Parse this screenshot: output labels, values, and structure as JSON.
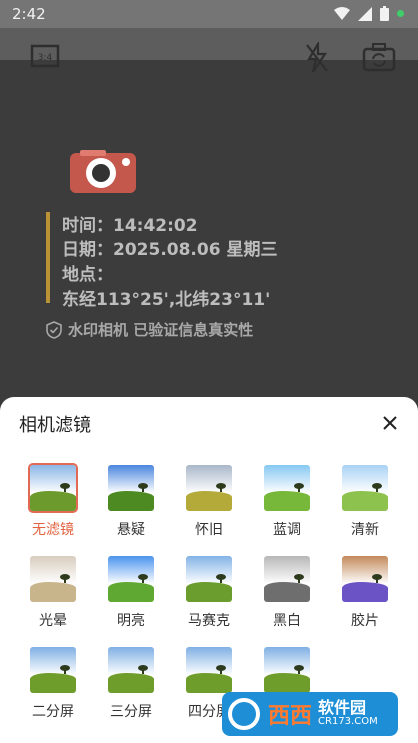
{
  "status": {
    "time": "2:42"
  },
  "watermark": {
    "time_line": "时间：14:42:02",
    "date_line": "日期：2025.08.06 星期三",
    "place_label": "地点：",
    "coords_line": "东经113°25',北纬23°11'",
    "verified": "水印相机 已验证信息真实性"
  },
  "sheet": {
    "title": "相机滤镜",
    "filters": [
      {
        "label": "无滤镜",
        "selected": true,
        "sky": "#8bb6e6",
        "grass": "#6c9a2d"
      },
      {
        "label": "悬疑",
        "selected": false,
        "sky": "#4a86dd",
        "grass": "#4d8a22"
      },
      {
        "label": "怀旧",
        "selected": false,
        "sky": "#a9b7c9",
        "grass": "#b3aa3a"
      },
      {
        "label": "蓝调",
        "selected": false,
        "sky": "#86c8f2",
        "grass": "#77b83a"
      },
      {
        "label": "清新",
        "selected": false,
        "sky": "#a9d2f4",
        "grass": "#8ec24f"
      },
      {
        "label": "光晕",
        "selected": false,
        "sky": "#d8cdbf",
        "grass": "#c8b58c"
      },
      {
        "label": "明亮",
        "selected": false,
        "sky": "#4b94ee",
        "grass": "#5fa832"
      },
      {
        "label": "马赛克",
        "selected": false,
        "sky": "#82b3e6",
        "grass": "#6a9c2e"
      },
      {
        "label": "黑白",
        "selected": false,
        "sky": "#b8b8b8",
        "grass": "#6e6e6e"
      },
      {
        "label": "胶片",
        "selected": false,
        "sky": "#c38a5b",
        "grass": "#6b53c5"
      },
      {
        "label": "二分屏",
        "selected": false,
        "sky": "#7fb0e4",
        "grass": "#6e9d2c"
      },
      {
        "label": "三分屏",
        "selected": false,
        "sky": "#7fb0e4",
        "grass": "#6e9d2c"
      },
      {
        "label": "四分屏",
        "selected": false,
        "sky": "#7fb0e4",
        "grass": "#6e9d2c"
      },
      {
        "label": "",
        "selected": false,
        "sky": "#7fb0e4",
        "grass": "#6e9d2c"
      }
    ]
  },
  "watermark_logo": {
    "big": "西西",
    "r1": "软件园",
    "r2": "CR173.COM"
  }
}
